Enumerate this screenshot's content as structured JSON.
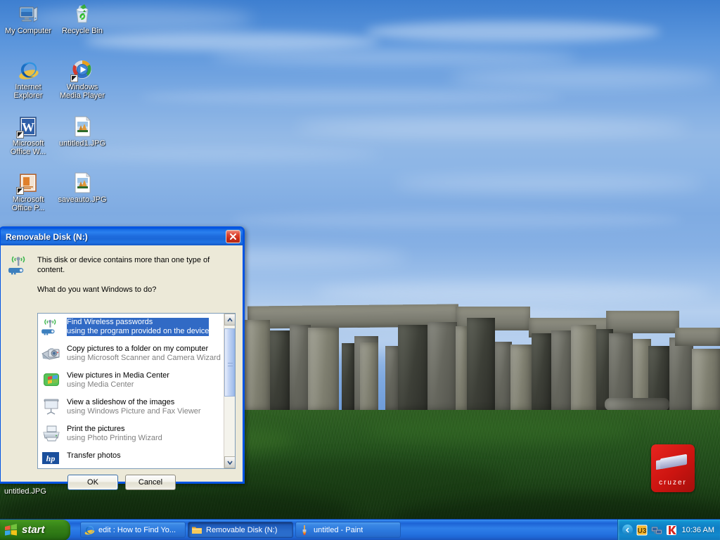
{
  "desktop": {
    "icons": [
      {
        "label": "My Computer",
        "icon": "my-computer-icon",
        "shortcut": false
      },
      {
        "label": "Recycle Bin",
        "icon": "recycle-bin-icon",
        "shortcut": false
      },
      {
        "label": "Internet Explorer",
        "icon": "internet-explorer-icon",
        "shortcut": false
      },
      {
        "label": "Windows Media Player",
        "icon": "windows-media-player-icon",
        "shortcut": true
      },
      {
        "label": "Microsoft Office W...",
        "icon": "microsoft-word-icon",
        "shortcut": true
      },
      {
        "label": "untitled1.JPG",
        "icon": "jpeg-thumbnail-icon",
        "shortcut": false
      },
      {
        "label": "Microsoft Office P...",
        "icon": "microsoft-powerpoint-icon",
        "shortcut": true
      },
      {
        "label": "saveauto.JPG",
        "icon": "jpeg-thumbnail-icon",
        "shortcut": false
      }
    ],
    "occluded_icon_label": "untitled.JPG",
    "u3_launchpad": {
      "label": "cruzer",
      "icon": "usb-flash-drive-icon",
      "color": "#cc1410"
    }
  },
  "dialog": {
    "title": "Removable Disk (N:)",
    "close_icon": "close-icon",
    "header_icon": "wireless-key-icon",
    "header_text": "This disk or device contains more than one type of content.",
    "question": "What do you want Windows to do?",
    "items": [
      {
        "title": "Find Wireless passwords",
        "subtitle": "using the program provided on the device",
        "icon": "wireless-key-icon",
        "selected": true
      },
      {
        "title": "Copy pictures to a folder on my computer",
        "subtitle": "using Microsoft Scanner and Camera Wizard",
        "icon": "scanner-camera-icon",
        "selected": false
      },
      {
        "title": "View pictures in Media Center",
        "subtitle": "using Media Center",
        "icon": "media-center-icon",
        "selected": false
      },
      {
        "title": "View a slideshow of the images",
        "subtitle": "using Windows Picture and Fax Viewer",
        "icon": "slideshow-projector-icon",
        "selected": false
      },
      {
        "title": "Print the pictures",
        "subtitle": "using Photo Printing Wizard",
        "icon": "printer-icon",
        "selected": false
      },
      {
        "title": "Transfer photos",
        "subtitle": "",
        "icon": "hp-logo-icon",
        "selected": false
      }
    ],
    "scroll": {
      "up_icon": "chevron-up-icon",
      "down_icon": "chevron-down-icon",
      "thumb_top_pct": 2,
      "thumb_height_pct": 52
    },
    "buttons": {
      "ok": "OK",
      "cancel": "Cancel"
    }
  },
  "taskbar": {
    "start": {
      "label": "start",
      "icon": "windows-flag-icon"
    },
    "tasks": [
      {
        "label": "edit : How to Find Yo...",
        "icon": "internet-explorer-icon",
        "active": false
      },
      {
        "label": "Removable Disk (N:)",
        "icon": "folder-icon",
        "active": true
      },
      {
        "label": "untitled - Paint",
        "icon": "paint-icon",
        "active": false
      }
    ],
    "tray": {
      "expand_icon": "chevron-left-icon",
      "icons": [
        {
          "name": "u3-launchpad-tray-icon",
          "label": "U3"
        },
        {
          "name": "network-connection-icon",
          "label": ""
        },
        {
          "name": "kaspersky-antivirus-icon",
          "label": "K"
        }
      ],
      "clock": "10:36 AM"
    }
  },
  "wallpaper": {
    "name": "stonehenge-wallpaper",
    "sky_color": "#7aa9e2",
    "grass_color": "#23501c",
    "stone_color": "#7c7d72"
  }
}
